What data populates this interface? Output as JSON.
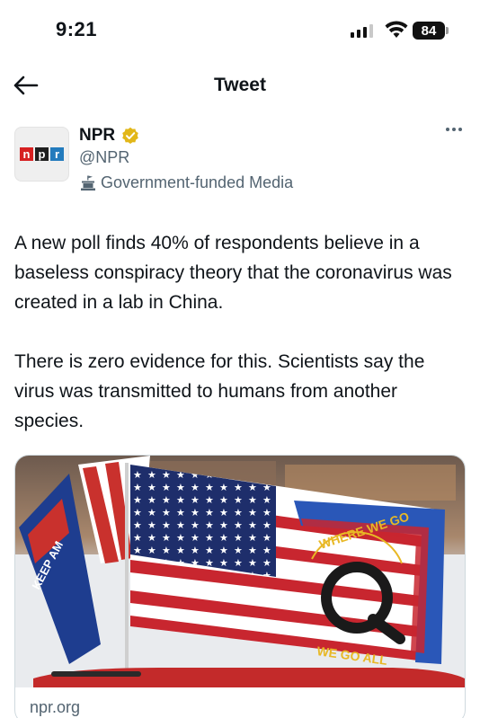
{
  "status_bar": {
    "time": "9:21",
    "battery": "84",
    "icons": [
      "cellular-signal-icon",
      "wifi-icon",
      "battery-icon"
    ]
  },
  "header": {
    "title": "Tweet",
    "back_icon": "back-arrow-icon"
  },
  "tweet": {
    "author": {
      "name": "NPR",
      "handle": "@NPR",
      "label": "Government-funded Media",
      "avatar_letters": [
        "n",
        "p",
        "r"
      ],
      "avatar_colors": [
        "#d62021",
        "#1f1f1f",
        "#237bbd"
      ],
      "verified_color": "#e2b719"
    },
    "text": "A new poll finds 40% of respondents believe in a baseless conspiracy theory that the coronavirus was created in a lab in China.\n\nThere is zero evidence for this. Scientists say the virus was transmitted to humans from another species.",
    "card": {
      "domain": "npr.org",
      "flag_banner_text": "WHERE WE GO ONE WE GO ALL",
      "left_flag_text": "KEEP AM..."
    }
  }
}
